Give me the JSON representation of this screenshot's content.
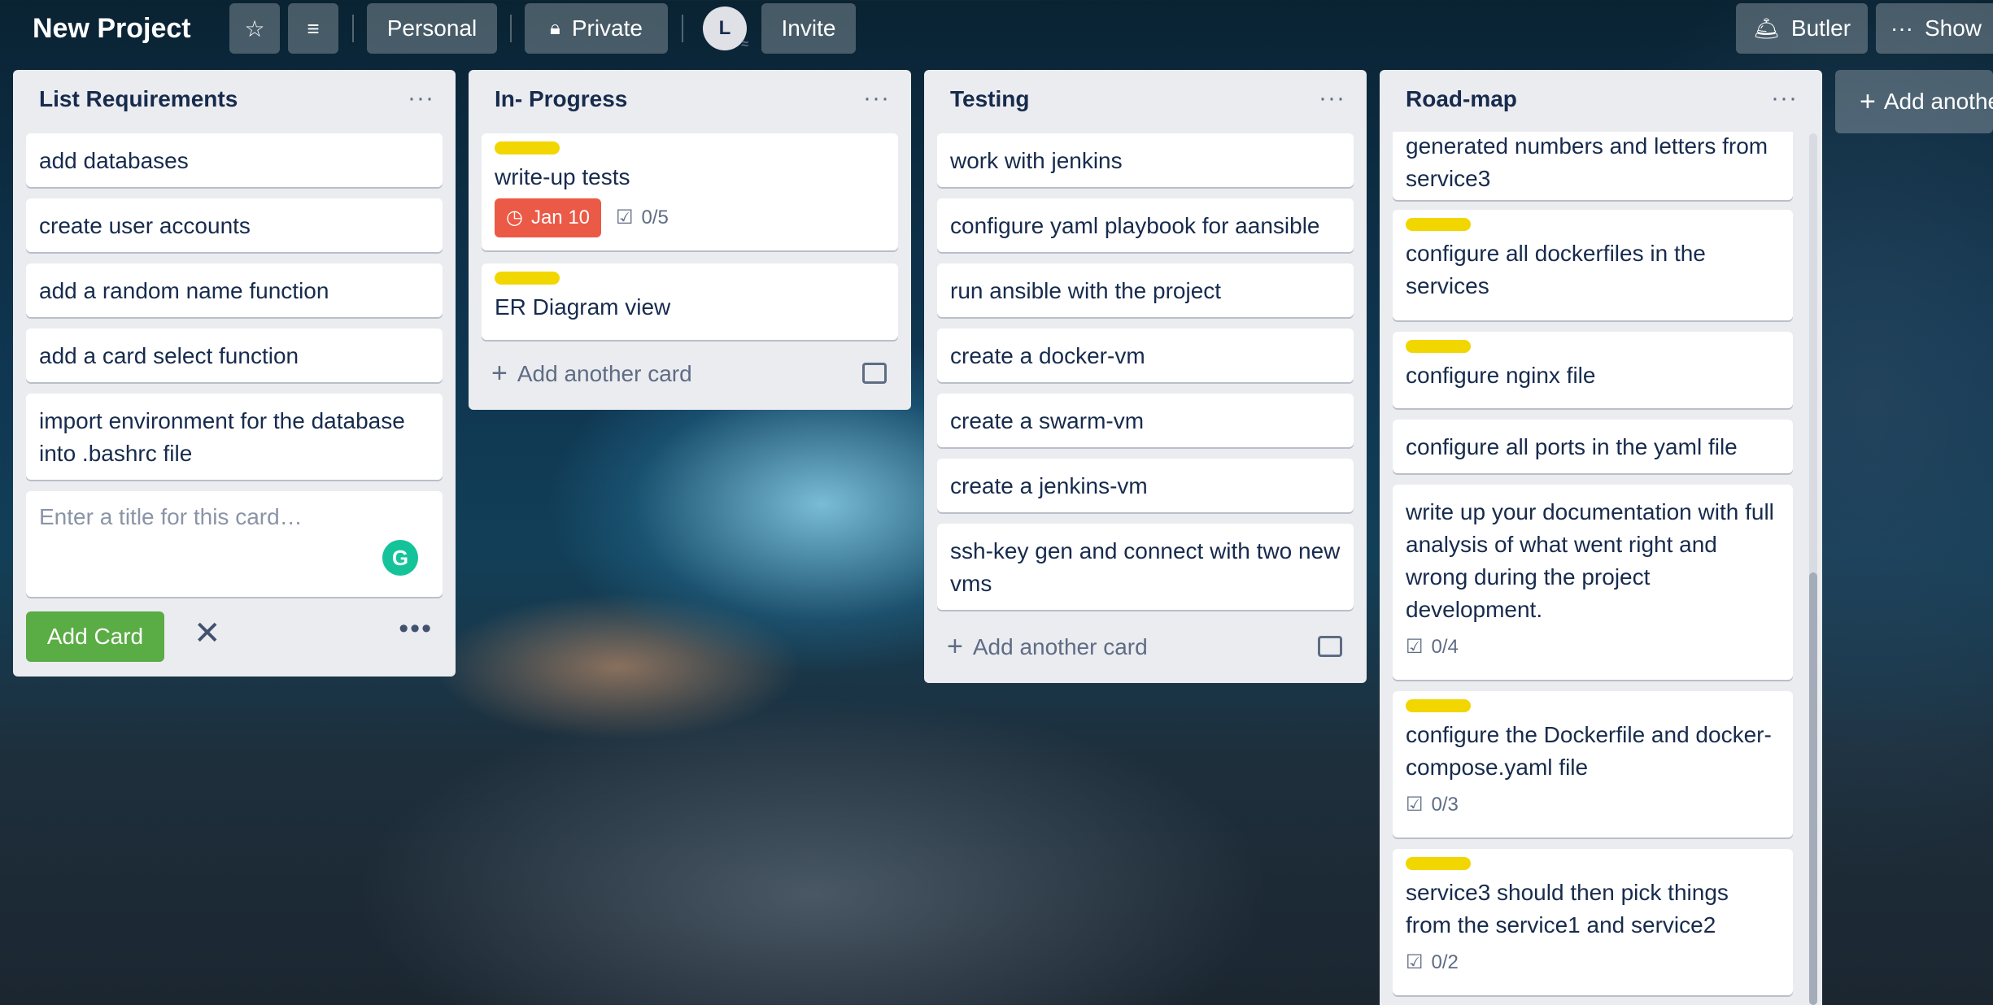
{
  "header": {
    "title": "New Project",
    "visibility_team": "Personal",
    "visibility": "Private",
    "avatar_initial": "L",
    "invite": "Invite",
    "butler": "Butler",
    "show_menu": "Show"
  },
  "lists": [
    {
      "title": "List Requirements",
      "cards": [
        {
          "title": "add databases"
        },
        {
          "title": "create user accounts"
        },
        {
          "title": "add a random name function"
        },
        {
          "title": "add a card select function"
        },
        {
          "title": "import environment for the database into .bashrc file"
        }
      ],
      "composer_placeholder": "Enter a title for this card…",
      "add_button": "Add Card"
    },
    {
      "title": "In- Progress",
      "cards": [
        {
          "title": "write-up tests",
          "label": "yellow",
          "due": "Jan 10",
          "checklist": "0/5"
        },
        {
          "title": "ER Diagram view",
          "label": "yellow"
        }
      ],
      "add_another": "Add another card"
    },
    {
      "title": "Testing",
      "cards": [
        {
          "title": "work with jenkins"
        },
        {
          "title": "configure yaml playbook for aansible"
        },
        {
          "title": "run ansible with the project"
        },
        {
          "title": "create a docker-vm"
        },
        {
          "title": "create a swarm-vm"
        },
        {
          "title": "create a jenkins-vm"
        },
        {
          "title": "ssh-key gen and connect with two new vms"
        }
      ],
      "add_another": "Add another card"
    },
    {
      "title": "Road-map",
      "cards": [
        {
          "title": "generated numbers and letters from service3"
        },
        {
          "title": "configure all dockerfiles in the services",
          "label": "yellow"
        },
        {
          "title": "configure nginx file",
          "label": "yellow"
        },
        {
          "title": "configure all ports in the yaml file"
        },
        {
          "title": "write up your documentation with full analysis of what went right and wrong during the project development.",
          "checklist": "0/4"
        },
        {
          "title": "configure the Dockerfile and docker-compose.yaml file",
          "label": "yellow",
          "checklist": "0/3"
        },
        {
          "title": "service3 should then pick things from the service1 and service2",
          "label": "yellow",
          "checklist": "0/2"
        }
      ]
    }
  ],
  "add_list": "Add another list",
  "colors": {
    "label_yellow": "#f2d600",
    "due_red": "#eb5a46",
    "add_green": "#5aac44"
  }
}
